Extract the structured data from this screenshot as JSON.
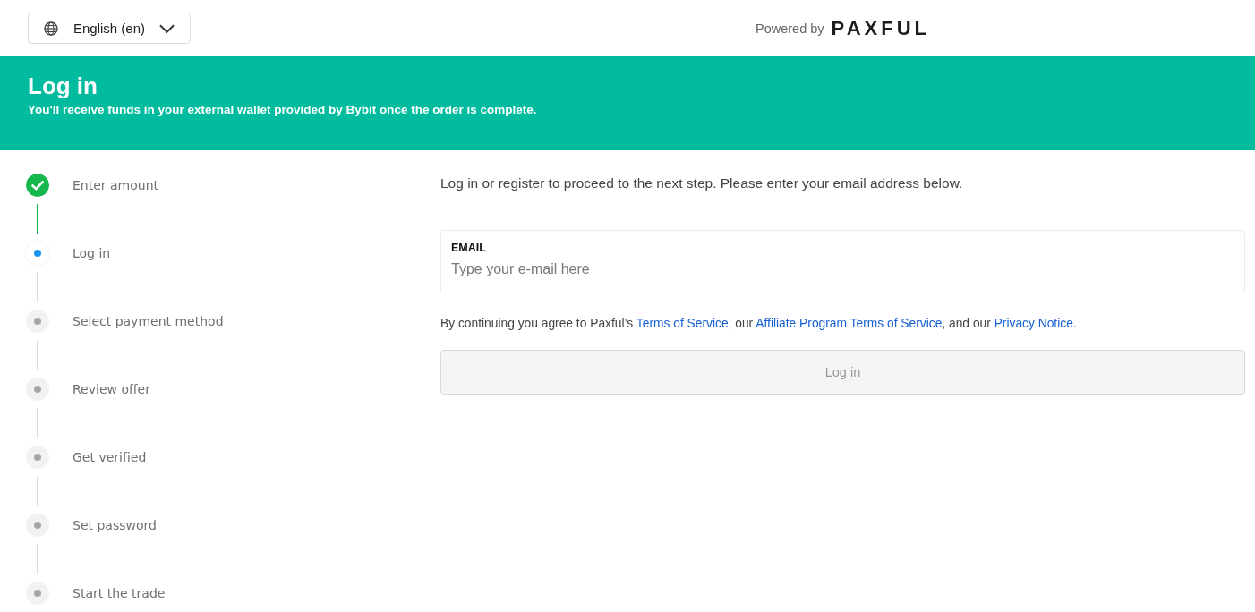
{
  "language_selector": {
    "label": "English (en)"
  },
  "branding": {
    "prefix": "Powered by",
    "logo": "PAXFUL"
  },
  "banner": {
    "title": "Log in",
    "subtitle": "You'll receive funds in your external wallet provided by Bybit once the order is complete."
  },
  "steps": [
    {
      "label": "Enter amount",
      "completed": true,
      "selected": false
    },
    {
      "label": "Log in",
      "completed": false,
      "selected": true
    },
    {
      "label": "Select payment method",
      "completed": false,
      "selected": false
    },
    {
      "label": "Review offer",
      "completed": false,
      "selected": false
    },
    {
      "label": "Get verified",
      "completed": false,
      "selected": false
    },
    {
      "label": "Set password",
      "completed": false,
      "selected": false
    },
    {
      "label": "Start the trade",
      "completed": false,
      "selected": false
    }
  ],
  "form": {
    "intro": "Log in or register to proceed to the next step. Please enter your email address below.",
    "email": {
      "label": "EMAIL",
      "placeholder": "Type your e-mail here"
    },
    "consent": [
      {
        "kind": "text",
        "text": "By continuing you agree to Paxful’s "
      },
      {
        "kind": "link",
        "text": "Terms of Service"
      },
      {
        "kind": "text",
        "text": ", our "
      },
      {
        "kind": "link",
        "text": "Affiliate Program Terms of Service"
      },
      {
        "kind": "text",
        "text": ", and our "
      },
      {
        "kind": "link",
        "text": "Privacy Notice"
      },
      {
        "kind": "text",
        "text": "."
      }
    ],
    "submit": {
      "label": "Log in",
      "disabled": true
    }
  }
}
